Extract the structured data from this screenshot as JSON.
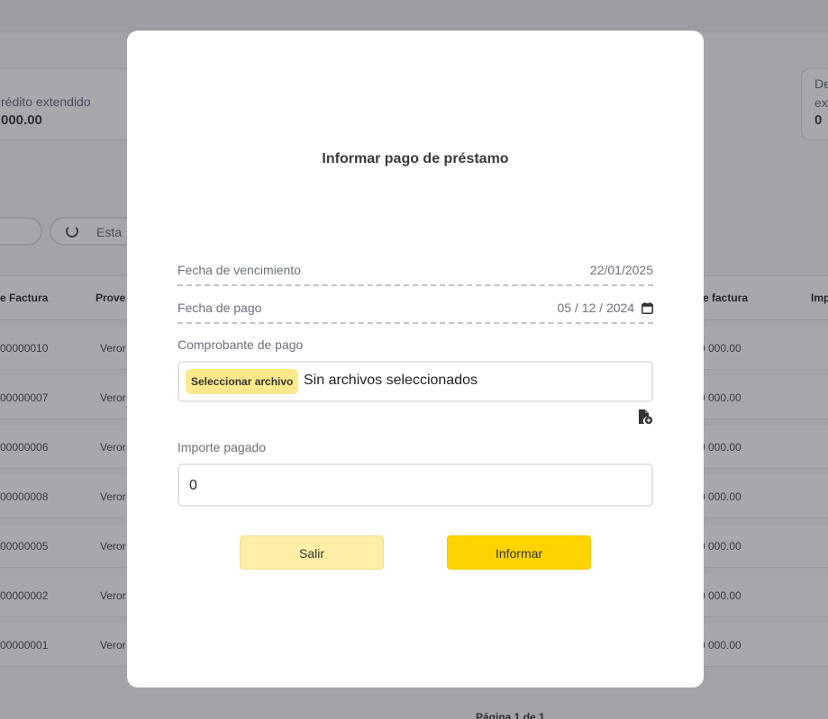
{
  "background": {
    "card_left": {
      "label": "rédito extendido",
      "value": "000.00"
    },
    "card_right": {
      "label_line1": "De",
      "label_line2": "ex",
      "value": "0"
    },
    "filter_pill_label": "Esta",
    "table_headers": [
      "e Factura",
      "Prove",
      "e factura",
      "Imp"
    ],
    "rows": [
      {
        "id": "00000010",
        "prov": "Veror",
        "amount": "0 000.00"
      },
      {
        "id": "00000007",
        "prov": "Veror",
        "amount": "0 000.00"
      },
      {
        "id": "00000006",
        "prov": "Veror",
        "amount": "0 000.00"
      },
      {
        "id": "00000008",
        "prov": "Veror",
        "amount": "0 000.00"
      },
      {
        "id": "00000005",
        "prov": "Veror",
        "amount": "0 000.00"
      },
      {
        "id": "00000002",
        "prov": "Veror",
        "amount": "0 000.00"
      },
      {
        "id": "00000001",
        "prov": "Veror",
        "amount": "0 000.00"
      }
    ],
    "footer_text": "Página 1 de 1"
  },
  "modal": {
    "title": "Informar pago de préstamo",
    "due_date": {
      "label": "Fecha de vencimiento",
      "value": "22/01/2025"
    },
    "payment_date": {
      "label": "Fecha de pago",
      "value": "05 / 12 / 2024"
    },
    "receipt": {
      "label": "Comprobante de pago",
      "button_label": "Seleccionar archivo",
      "status": "Sin archivos seleccionados"
    },
    "amount": {
      "label": "Importe pagado",
      "value": "0"
    },
    "buttons": {
      "cancel": "Salir",
      "submit": "Informar"
    }
  },
  "colors": {
    "accent": "#ffd400",
    "accent_light": "#fdf0a6",
    "overlay": "#3c3e46"
  },
  "icons": [
    "calendar-icon",
    "file-add-icon",
    "loading-spinner-icon"
  ]
}
